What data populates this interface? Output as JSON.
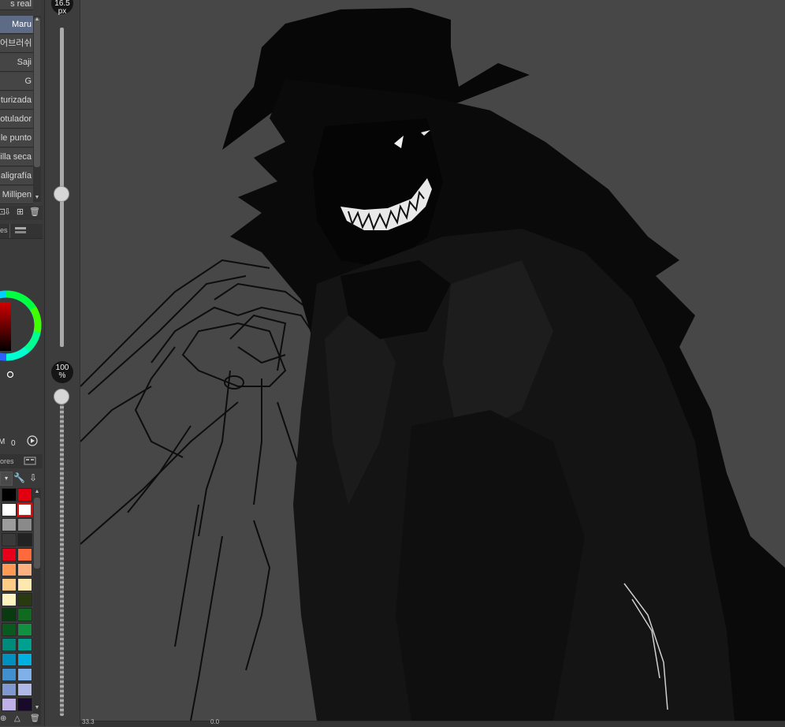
{
  "brush_panel": {
    "top_partial_label": "s real",
    "items": [
      {
        "label": "Maru",
        "selected": true
      },
      {
        "label": "어브러쉬",
        "selected": false
      },
      {
        "label": "Saji",
        "selected": false
      },
      {
        "label": "G",
        "selected": false
      },
      {
        "label": "turizada",
        "selected": false
      },
      {
        "label": "otulador",
        "selected": false
      },
      {
        "label": "le punto",
        "selected": false
      },
      {
        "label": "illa seca",
        "selected": false
      },
      {
        "label": "aligrafía",
        "selected": false
      },
      {
        "label": "Millipen",
        "selected": false
      }
    ]
  },
  "color_panel": {
    "tab_partial": "es",
    "value_readout": "0",
    "current_color": "#a00000"
  },
  "palette_panel": {
    "tab_partial": "ores",
    "rows": [
      [
        "#000000",
        "#e00010"
      ],
      [
        "#ffffff",
        "#ffffff"
      ],
      [
        "#9c9c9c",
        "#8a8a8a"
      ],
      [
        "#3a3a3a",
        "#222222"
      ],
      [
        "#e6001a",
        "#ff6a3c"
      ],
      [
        "#ff9955",
        "#ffb080"
      ],
      [
        "#ffcc88",
        "#ffe8b0"
      ],
      [
        "#fff4c0",
        "#2a3a10"
      ],
      [
        "#0a3a10",
        "#106a20"
      ],
      [
        "#0a5a20",
        "#109040"
      ],
      [
        "#008a7a",
        "#00a090"
      ],
      [
        "#0090c0",
        "#00b0e0"
      ],
      [
        "#4090d0",
        "#80b0e8"
      ],
      [
        "#8098d0",
        "#b0b8e8"
      ],
      [
        "#c0b0e8",
        "#1a0a2a"
      ]
    ]
  },
  "size_slider": {
    "value": "16.5",
    "unit": "px",
    "level": 0.48
  },
  "opacity_slider": {
    "value": "100",
    "unit": "%",
    "level": 1.0
  },
  "canvas": {
    "background": "#474747"
  },
  "status_bar": {
    "zoom_partial": "33.3",
    "rotation_partial": "0.0"
  }
}
